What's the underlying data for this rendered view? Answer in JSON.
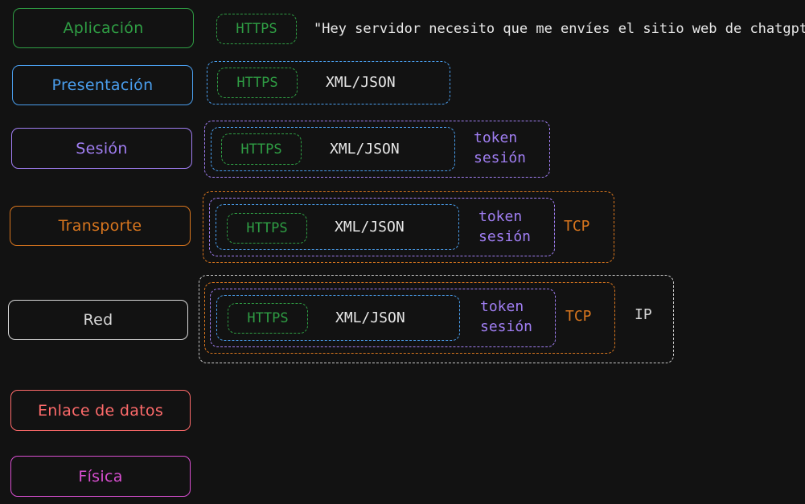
{
  "layers": {
    "aplicacion": "Aplicación",
    "presentacion": "Presentación",
    "sesion": "Sesión",
    "transporte": "Transporte",
    "red": "Red",
    "enlace": "Enlace de datos",
    "fisica": "Física"
  },
  "labels": {
    "https": "HTTPS",
    "xml_json": "XML/JSON",
    "token_line1": "token",
    "token_line2": "sesión",
    "tcp": "TCP",
    "ip": "IP"
  },
  "message": "\"Hey servidor necesito que me envíes el sitio web de chatgpt\"",
  "colors": {
    "green": "#2f9e44",
    "blue": "#4a9eed",
    "purple": "#a07ef2",
    "orange": "#d9761e",
    "white": "#d8d8d8",
    "red": "#ff6b6b",
    "magenta": "#d94fd1",
    "background": "#121212"
  }
}
